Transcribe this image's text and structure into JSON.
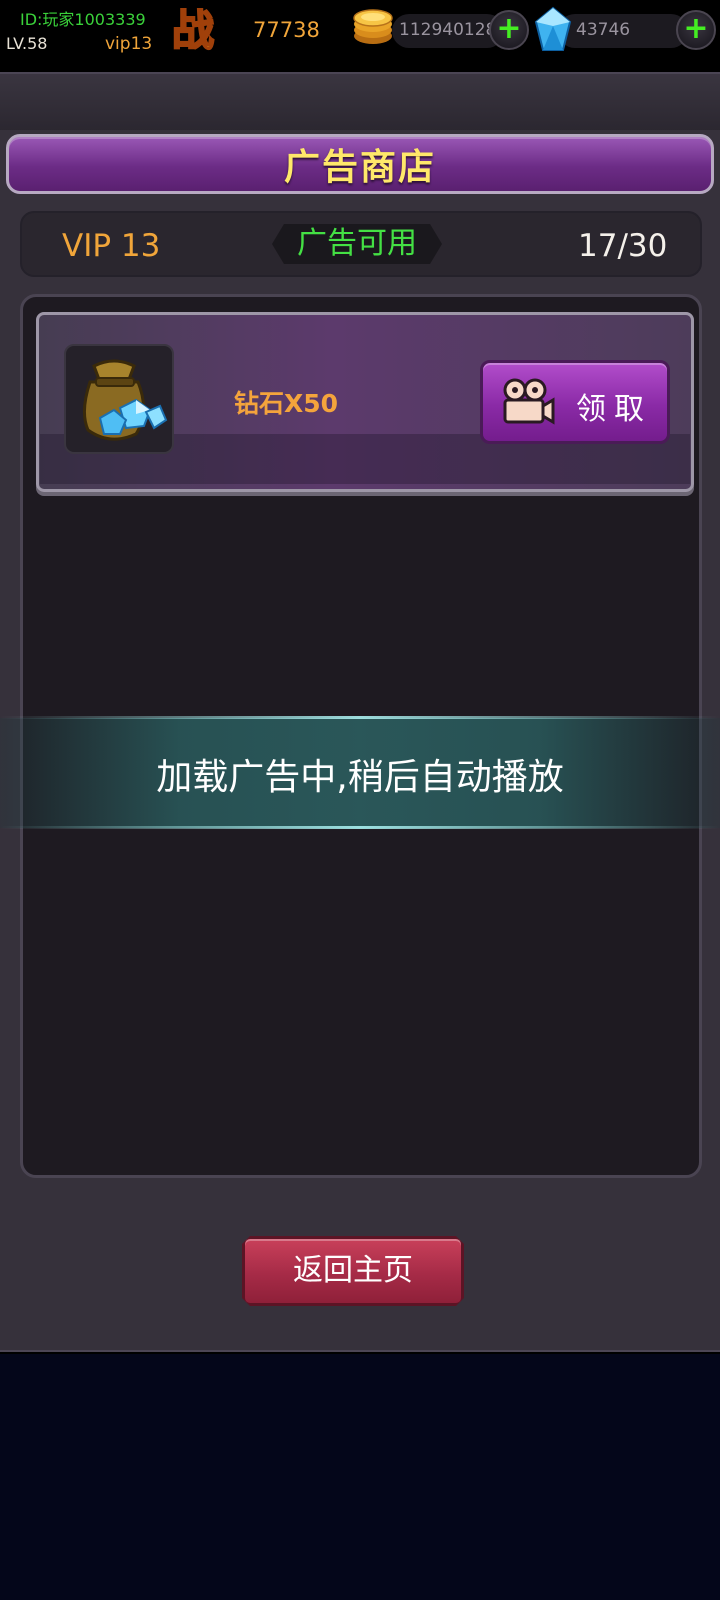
{
  "status_bar": {
    "player_id": "ID:玩家1003339",
    "level": "LV.58",
    "vip": "vip13",
    "power_icon": "zhan-badge-icon",
    "power_value": "77738",
    "coins": "112940128",
    "gems": "43746"
  },
  "shop": {
    "title": "广告商店",
    "vip_label": "VIP 13",
    "ad_status": "广告可用",
    "ad_count": "17/30"
  },
  "offers": [
    {
      "name": "钻石X50",
      "icon": "diamond-bag-icon",
      "button_label": "领取"
    }
  ],
  "toast": {
    "message": "加载广告中,稍后自动播放"
  },
  "footer": {
    "back_label": "返回主页"
  },
  "colors": {
    "banner_purple": "#6c2c86",
    "accent_orange": "#f0a53a",
    "status_green": "#44e044",
    "title_yellow": "#ffe86a",
    "back_red": "#a62b47"
  }
}
